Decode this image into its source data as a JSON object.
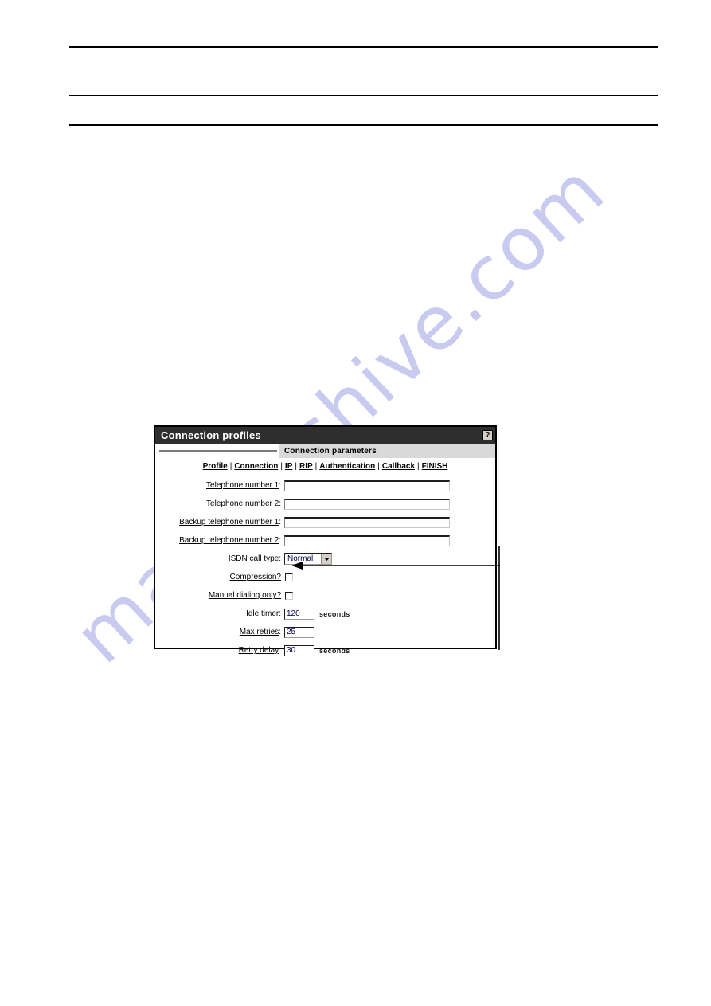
{
  "page": {
    "rules": [
      "rule-1",
      "rule-2",
      "rule-3"
    ],
    "watermark": "manualshive.com"
  },
  "dialog": {
    "title": "Connection profiles",
    "help_label": "?",
    "section_title": "Connection parameters",
    "nav": [
      {
        "label": "Profile"
      },
      {
        "label": "Connection"
      },
      {
        "label": "IP"
      },
      {
        "label": "RIP"
      },
      {
        "label": "Authentication"
      },
      {
        "label": "Callback"
      },
      {
        "label": "FINISH"
      }
    ],
    "nav_separator": "|",
    "fields": {
      "telephone_number_1": {
        "label": "Telephone number 1",
        "suffix": ":",
        "value": "",
        "placeholder": ""
      },
      "telephone_number_2": {
        "label": "Telephone number 2",
        "suffix": ":",
        "value": "",
        "placeholder": ""
      },
      "backup_telephone_number_1": {
        "label": "Backup telephone number 1",
        "suffix": ":",
        "value": "",
        "placeholder": ""
      },
      "backup_telephone_number_2": {
        "label": "Backup telephone number 2",
        "suffix": ":",
        "value": "",
        "placeholder": ""
      },
      "isdn_call_type": {
        "label": "ISDN call type",
        "suffix": ":",
        "value": "Normal",
        "options": [
          "Normal"
        ]
      },
      "compression": {
        "label": "Compression?",
        "suffix": "",
        "checked": false
      },
      "manual_dialing_only": {
        "label": "Manual dialing only?",
        "suffix": "",
        "checked": false
      },
      "idle_timer": {
        "label": "Idle timer",
        "suffix": ":",
        "value": "120",
        "unit": "seconds"
      },
      "max_retries": {
        "label": "Max retries",
        "suffix": ":",
        "value": "25",
        "unit": ""
      },
      "retry_delay": {
        "label": "Retry delay",
        "suffix": ":",
        "value": "30",
        "unit": "seconds"
      }
    }
  },
  "colors": {
    "titlebar": "#2e2e2e",
    "section_band": "#d9d9d9",
    "watermark": "#c9caf0",
    "rule": "#000000"
  }
}
